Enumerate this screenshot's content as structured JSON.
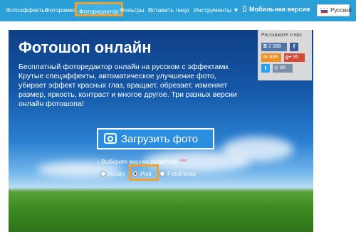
{
  "nav": {
    "items": [
      {
        "label": "Фотоэффекты"
      },
      {
        "label": "Фоторамки"
      },
      {
        "label": "Фоторедактор"
      },
      {
        "label": "Фильтры"
      },
      {
        "label": "Вставить лицо"
      },
      {
        "label": "Инструменты ▼"
      }
    ],
    "mobile_label": "Мобильная версия",
    "language": "Русский"
  },
  "hero": {
    "title": "Фотошоп онлайн",
    "description": "Бесплатный фоторедактор онлайн на русском с эффектами. Крутые спецэффекты, автоматическое улучшение фото, убирает эффект красных глаз, вращает, обрезает, изменяет размер, яркость, контраст и многое другое. Три разных версии онлайн фотошопа!",
    "upload_label": "Загрузить фото",
    "choose_label": "↓ Выберите версию редактора",
    "new_badge": "new",
    "options": [
      {
        "label": "Aviary",
        "selected": false
      },
      {
        "label": "Pixlr",
        "selected": true
      },
      {
        "label": "FotoFlexer",
        "selected": false
      }
    ]
  },
  "share": {
    "heading": "Расскажите о нас",
    "vk_count": "2 088",
    "ok_count": "899",
    "gplus_count": "95",
    "other_count": "85"
  },
  "colors": {
    "topbar": "#2a9fd8",
    "highlight": "#f0a030",
    "vk": "#5077a8",
    "facebook": "#3b5998",
    "odnoklassniki": "#f08e22",
    "googleplus": "#d34836",
    "twitter": "#2aa3ef"
  }
}
